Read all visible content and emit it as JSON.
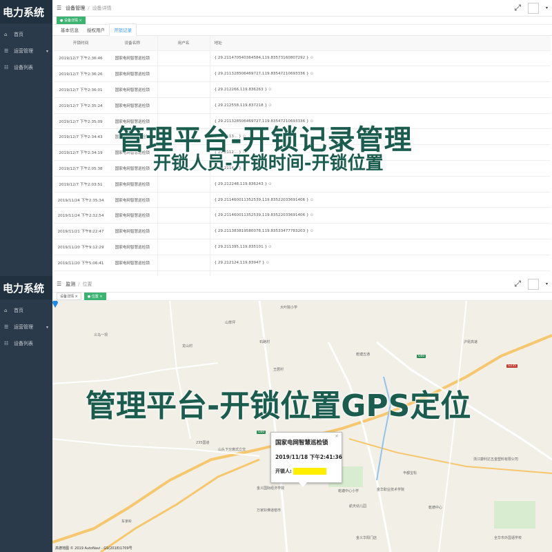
{
  "app_title": "电力系统",
  "sidebar": {
    "items": [
      {
        "label": "首页"
      },
      {
        "label": "运营管理"
      },
      {
        "label": "设备列表"
      }
    ]
  },
  "top_view": {
    "breadcrumb": [
      "设备管理",
      "设备详情"
    ],
    "tags": [
      "设备详情"
    ],
    "subtabs": [
      "基本信息",
      "授权用户",
      "开锁记录"
    ],
    "active_subtab": 2,
    "columns": [
      "开锁时间",
      "设备名称",
      "用户名",
      "地址"
    ],
    "rows": [
      {
        "time": "2019/12/7 下午2:36:46",
        "device": "国家电网智慧巡检锁",
        "user": "",
        "address": "{ 29.211470540364584,119.83573160807292 }"
      },
      {
        "time": "2019/12/7 下午2:36:26",
        "device": "国家电网智慧巡检锁",
        "user": "",
        "address": "{ 29.211328506469727,119.83547210693336 }"
      },
      {
        "time": "2019/12/7 下午2:36:01",
        "device": "国家电网智慧巡检锁",
        "user": "",
        "address": "{ 29.212266,119.836263 }"
      },
      {
        "time": "2019/12/7 下午2:35:24",
        "device": "国家电网智慧巡检锁",
        "user": "",
        "address": "{ 29.212558,119.837218 }"
      },
      {
        "time": "2019/12/7 下午2:35:09",
        "device": "国家电网智慧巡检锁",
        "user": "",
        "address": "{ 29.211328506469727,119.83547210693336 }"
      },
      {
        "time": "2019/12/7 下午2:34:43",
        "device": "国家电网智慧巡检锁",
        "user": "",
        "address": "{ 29.2113... }"
      },
      {
        "time": "2019/12/7 下午2:34:19",
        "device": "国家电网智慧巡检锁",
        "user": "",
        "address": "{ 29.2112... }"
      },
      {
        "time": "2019/12/7 下午2:05:38",
        "device": "国家电网智慧巡检锁",
        "user": "",
        "address": "{ 29.2114... }"
      },
      {
        "time": "2019/12/7 下午2:03:51",
        "device": "国家电网智慧巡检锁",
        "user": "",
        "address": "{ 29.212248,119.836243 }"
      },
      {
        "time": "2019/11/24 下午2:35:34",
        "device": "国家电网智慧巡检锁",
        "user": "",
        "address": "{ 29.211460011352539,119.83522033691406 }"
      },
      {
        "time": "2019/11/24 下午2:32:54",
        "device": "国家电网智慧巡检锁",
        "user": "",
        "address": "{ 29.211460011352539,119.83522033691406 }"
      },
      {
        "time": "2019/11/21 下午8:22:47",
        "device": "国家电网智慧巡检锁",
        "user": "",
        "address": "{ 29.211383819580078,119.83533477783203 }"
      },
      {
        "time": "2019/11/20 下午9:12:29",
        "device": "国家电网智慧巡检锁",
        "user": "",
        "address": "{ 29.211395,119.835101 }"
      },
      {
        "time": "2019/11/20 下午5:06:41",
        "device": "国家电网智慧巡检锁",
        "user": "",
        "address": "{ 29.212124,119.83947 }"
      },
      {
        "time": "2019/11/20 下午5:07:29",
        "device": "国家电网智慧巡检锁",
        "user": "",
        "address": "{ 29.212124,119.83947 }"
      },
      {
        "time": "2019/11/20 下午5:02:18",
        "device": "国家电网智慧巡检锁",
        "user": "",
        "address": "{ 29.211439132690430,119.83533477783203 }"
      }
    ],
    "overlay_title": "管理平台-开锁记录管理",
    "overlay_subtitle": "开锁人员-开锁时间-开锁位置"
  },
  "bottom_view": {
    "breadcrumb": [
      "监测",
      "位置"
    ],
    "tags": [
      "设备详情",
      "位置"
    ],
    "overlay_title": "管理平台-开锁位置GPS定位",
    "popup": {
      "title": "国家电网智慧巡检锁",
      "time": "2019/11/18 下午2:41:36",
      "unlocker_label": "开锁人:"
    },
    "copyright": "高德地图 © 2019 AutoNavi - GS(2018)1709号",
    "map_labels": [
      "大叶院小学",
      "山草坪",
      "义乌一坝",
      "龙山村",
      "石路村",
      "王居村",
      "全义乌城",
      "乾塘五通",
      "沪昆高速",
      "235国道",
      "山头下分离式立交",
      "金义国际经济学院",
      "万家好佛道窑市",
      "乾塘中心小学",
      "航天幼儿园",
      "车家岭",
      "丰都宝松",
      "浙江康利达五金塑料有限公司",
      "金华职业技术学院",
      "金义华阳门店",
      "乾德中心",
      "全华市外国语学校"
    ]
  }
}
